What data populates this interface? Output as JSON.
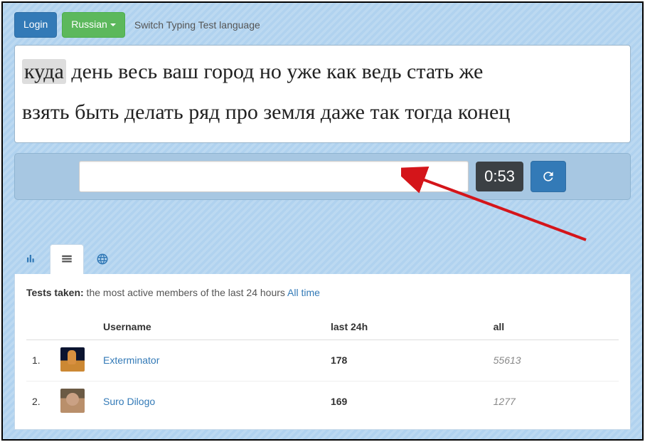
{
  "topbar": {
    "login_label": "Login",
    "language_label": "Russian",
    "switch_label": "Switch Typing Test language"
  },
  "words": {
    "highlighted": "куда",
    "line1_rest": " день весь ваш город но уже как ведь стать же",
    "line2": "взять быть делать ряд про земля даже так тогда конец"
  },
  "timer": "0:53",
  "tests_label": "Tests taken:",
  "tests_desc": " the most active members of the last 24 hours ",
  "all_time_link": "All time",
  "table": {
    "headers": {
      "username": "Username",
      "last24": "last 24h",
      "all": "all"
    },
    "rows": [
      {
        "rank": "1.",
        "name": "Exterminator",
        "last24": "178",
        "all": "55613"
      },
      {
        "rank": "2.",
        "name": "Suro Dilogo",
        "last24": "169",
        "all": "1277"
      }
    ]
  }
}
